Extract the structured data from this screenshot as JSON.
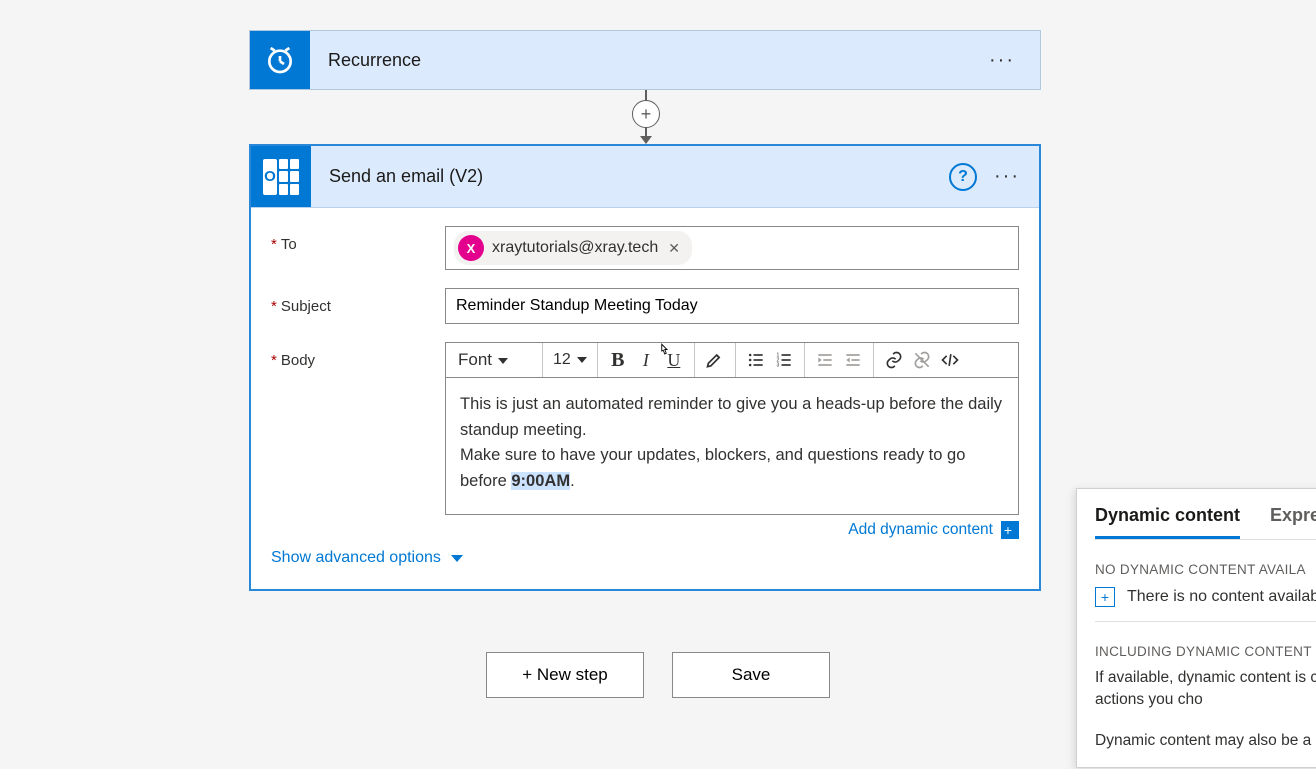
{
  "trigger": {
    "title": "Recurrence"
  },
  "plus_label": "+",
  "action": {
    "title": "Send an email (V2)",
    "help_label": "?",
    "fields": {
      "to": {
        "label": "To",
        "chip": {
          "initial": "X",
          "email": "xraytutorials@xray.tech"
        }
      },
      "subject": {
        "label": "Subject",
        "value": "Reminder Standup Meeting Today"
      },
      "body": {
        "label": "Body",
        "toolbar": {
          "font_label": "Font",
          "size_label": "12"
        },
        "content": {
          "p1": "This is just an automated reminder to give you a heads-up before the daily standup meeting.",
          "p2a": "Make sure to have your updates, blockers, and questions ready to go before ",
          "p2b": "9:00AM",
          "p2c": "."
        }
      }
    },
    "add_dynamic_label": "Add dynamic content",
    "advanced_label": "Show advanced options"
  },
  "buttons": {
    "new_step": "+ New step",
    "save": "Save"
  },
  "dyn_panel": {
    "tab_dynamic": "Dynamic content",
    "tab_expression": "Expres",
    "sec1_title": "NO DYNAMIC CONTENT AVAILA",
    "sec1_text": "There is no content availab",
    "sec2_title": "INCLUDING DYNAMIC CONTENT",
    "sec2_text": "If available, dynamic content is connectors and actions you cho",
    "sec3_text": "Dynamic content may also be a"
  },
  "icons": {
    "clock": "clock-icon",
    "outlook": "outlook-icon"
  }
}
